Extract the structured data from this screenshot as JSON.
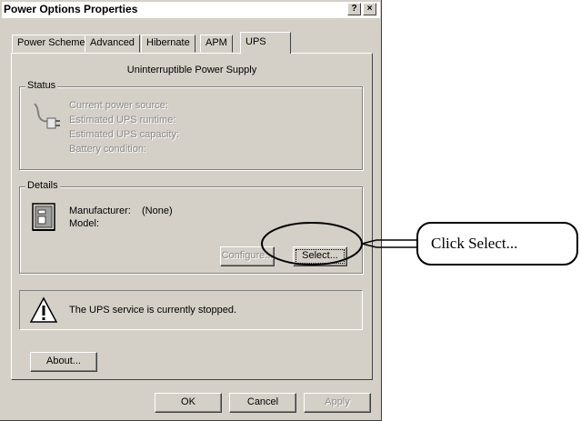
{
  "window": {
    "title": "Power Options Properties",
    "help_glyph": "?",
    "close_glyph": "×"
  },
  "tabs": [
    {
      "label": "Power Schemes"
    },
    {
      "label": "Advanced"
    },
    {
      "label": "Hibernate"
    },
    {
      "label": "APM"
    },
    {
      "label": "UPS"
    }
  ],
  "ups_panel": {
    "heading": "Uninterruptible Power Supply",
    "status_group": {
      "label": "Status",
      "lines": [
        "Current power source:",
        "Estimated UPS runtime:",
        "Estimated UPS capacity:",
        "Battery condition:"
      ]
    },
    "details_group": {
      "label": "Details",
      "manufacturer_label": "Manufacturer:",
      "manufacturer_value": "(None)",
      "model_label": "Model:",
      "configure_button": "Configure...",
      "select_button": "Select..."
    },
    "service_message": "The UPS service is currently stopped.",
    "about_button": "About..."
  },
  "footer": {
    "ok": "OK",
    "cancel": "Cancel",
    "apply": "Apply"
  },
  "annotation": {
    "callout_text": "Click Select..."
  }
}
